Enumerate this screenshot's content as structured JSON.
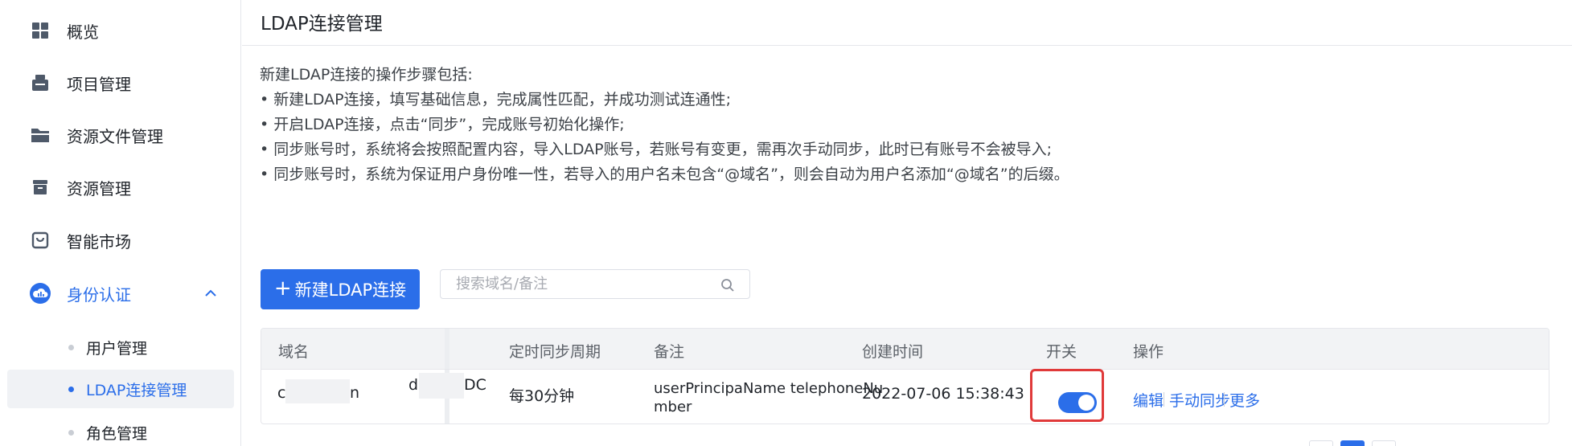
{
  "sidebar": {
    "items": [
      {
        "label": "概览",
        "icon": "dashboard-grid-icon"
      },
      {
        "label": "项目管理",
        "icon": "project-stack-icon"
      },
      {
        "label": "资源文件管理",
        "icon": "folder-icon"
      },
      {
        "label": "资源管理",
        "icon": "box-icon"
      },
      {
        "label": "智能市场",
        "icon": "shopping-bag-icon"
      },
      {
        "label": "身份认证",
        "icon": "identity-cloud-icon",
        "expanded": true
      }
    ],
    "sub_items": [
      {
        "label": "用户管理"
      },
      {
        "label": "LDAP连接管理",
        "active": true
      },
      {
        "label": "角色管理"
      }
    ]
  },
  "main": {
    "title": "LDAP连接管理",
    "description": {
      "intro": "新建LDAP连接的操作步骤包括:",
      "steps": [
        "• 新建LDAP连接，填写基础信息，完成属性匹配，并成功测试连通性;",
        "• 开启LDAP连接，点击“同步”，完成账号初始化操作;",
        "• 同步账号时，系统将会按照配置内容，导入LDAP账号，若账号有变更，需再次手动同步，此时已有账号不会被导入;",
        "• 同步账号时，系统为保证用户身份唯一性，若导入的用户名未包含“@域名”，则会自动为用户名添加“@域名”的后缀。"
      ]
    },
    "add_button": {
      "plus": "+",
      "label": "新建LDAP连接"
    },
    "search": {
      "placeholder": "搜索域名/备注",
      "value": ""
    },
    "table": {
      "headers": {
        "domain": "域名",
        "period": "定时同步周期",
        "remark": "备注",
        "created": "创建时间",
        "switch": "开关",
        "ops": "操作"
      },
      "rows": [
        {
          "domain_start": "c",
          "domain_end": "n",
          "base_start": "d",
          "base_end": "DC",
          "period": "每30分钟",
          "remark": "userPrincipaName telephoneNumber",
          "created": "2022-07-06 15:38:43",
          "switch_on": true,
          "ops": {
            "edit": "编辑",
            "sync": "手动同步",
            "more": "更多"
          }
        }
      ]
    }
  },
  "colors": {
    "accent": "#2b6ee9",
    "highlight": "#e03a3a"
  }
}
